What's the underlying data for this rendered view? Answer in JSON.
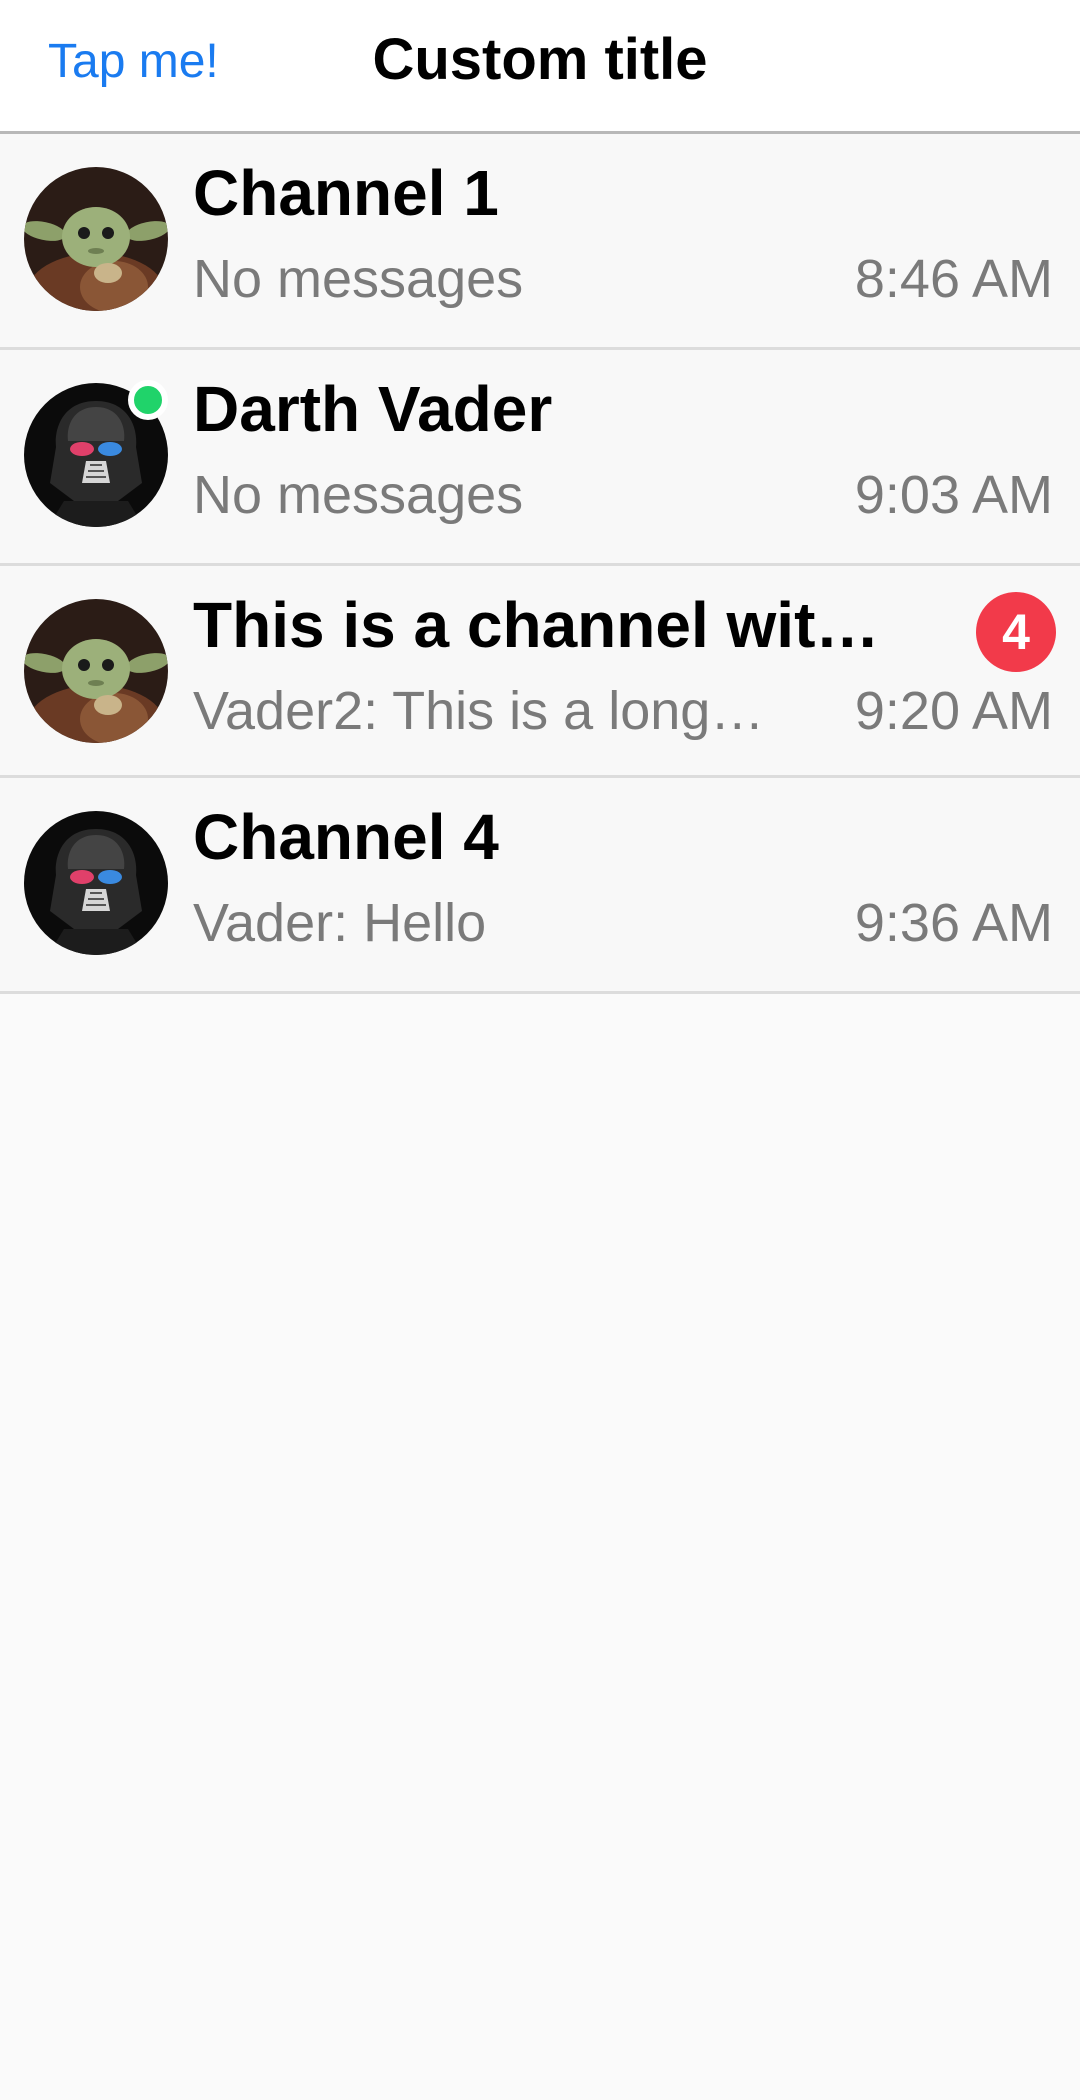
{
  "nav": {
    "left_button": "Tap me!",
    "title": "Custom title"
  },
  "channels": [
    {
      "name": "Channel 1",
      "preview": "No messages",
      "time": "8:46 AM",
      "avatar": "yoda-avatar",
      "online": false,
      "unread": null
    },
    {
      "name": "Darth Vader",
      "preview": "No messages",
      "time": "9:03 AM",
      "avatar": "vader-avatar",
      "online": true,
      "unread": null
    },
    {
      "name": "This is a channel with…",
      "preview": "Vader2: This is a long…",
      "time": "9:20 AM",
      "avatar": "yoda-avatar",
      "online": false,
      "unread": "4"
    },
    {
      "name": "Channel 4",
      "preview": "Vader: Hello",
      "time": "9:36 AM",
      "avatar": "vader-avatar",
      "online": false,
      "unread": null
    }
  ],
  "colors": {
    "accent": "#1a7bf0",
    "online": "#20d36a",
    "badge": "#f23a4a",
    "secondary_text": "#7a7a7a"
  }
}
